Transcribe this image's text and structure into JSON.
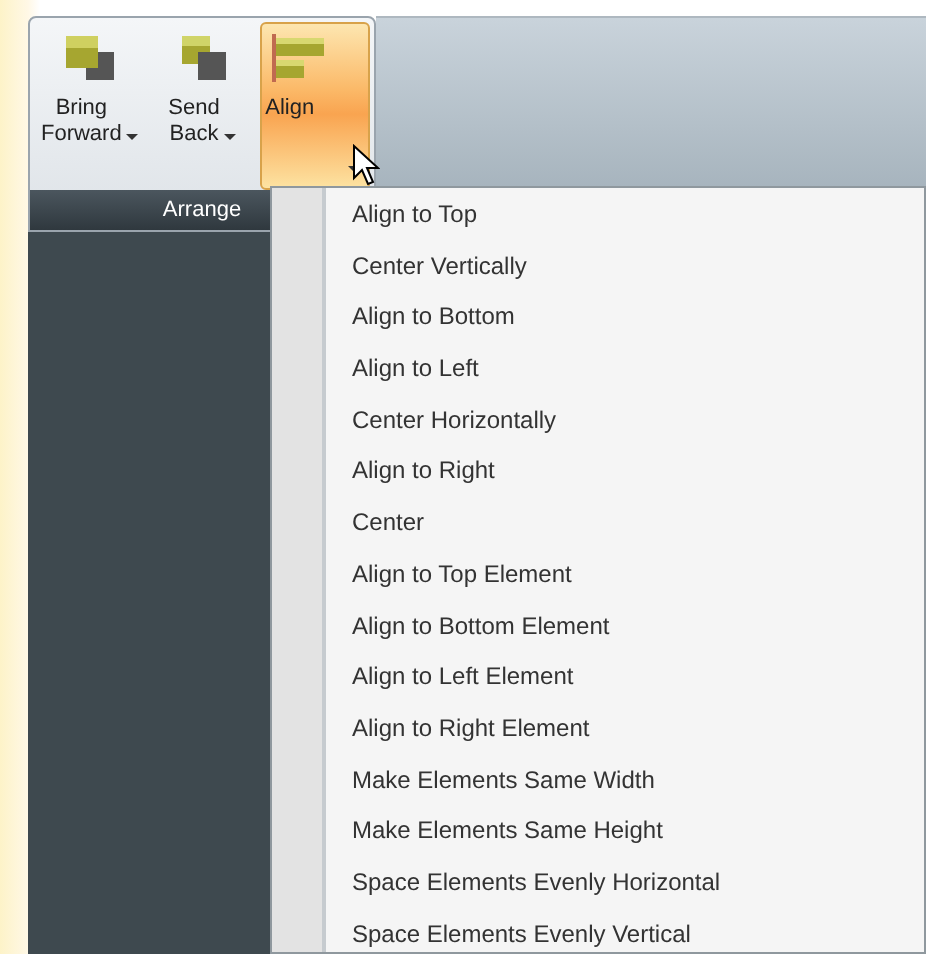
{
  "ribbon": {
    "buttons": [
      {
        "lines": [
          "Bring",
          "Forward"
        ],
        "dropdown": true,
        "selected": false
      },
      {
        "lines": [
          "Send",
          "Back"
        ],
        "dropdown": true,
        "selected": false
      },
      {
        "lines": [
          "Align"
        ],
        "dropdown": true,
        "selected": true
      }
    ],
    "group_label": "Arrange"
  },
  "menu": {
    "items": [
      "Align to Top",
      "Center Vertically",
      "Align to Bottom",
      "Align to Left",
      "Center Horizontally",
      "Align to Right",
      "Center",
      "Align to Top Element",
      "Align to Bottom Element",
      "Align to Left Element",
      "Align to Right Element",
      "Make Elements Same Width",
      "Make Elements Same Height",
      "Space Elements Evenly Horizontal",
      "Space Elements Evenly Vertical"
    ]
  }
}
